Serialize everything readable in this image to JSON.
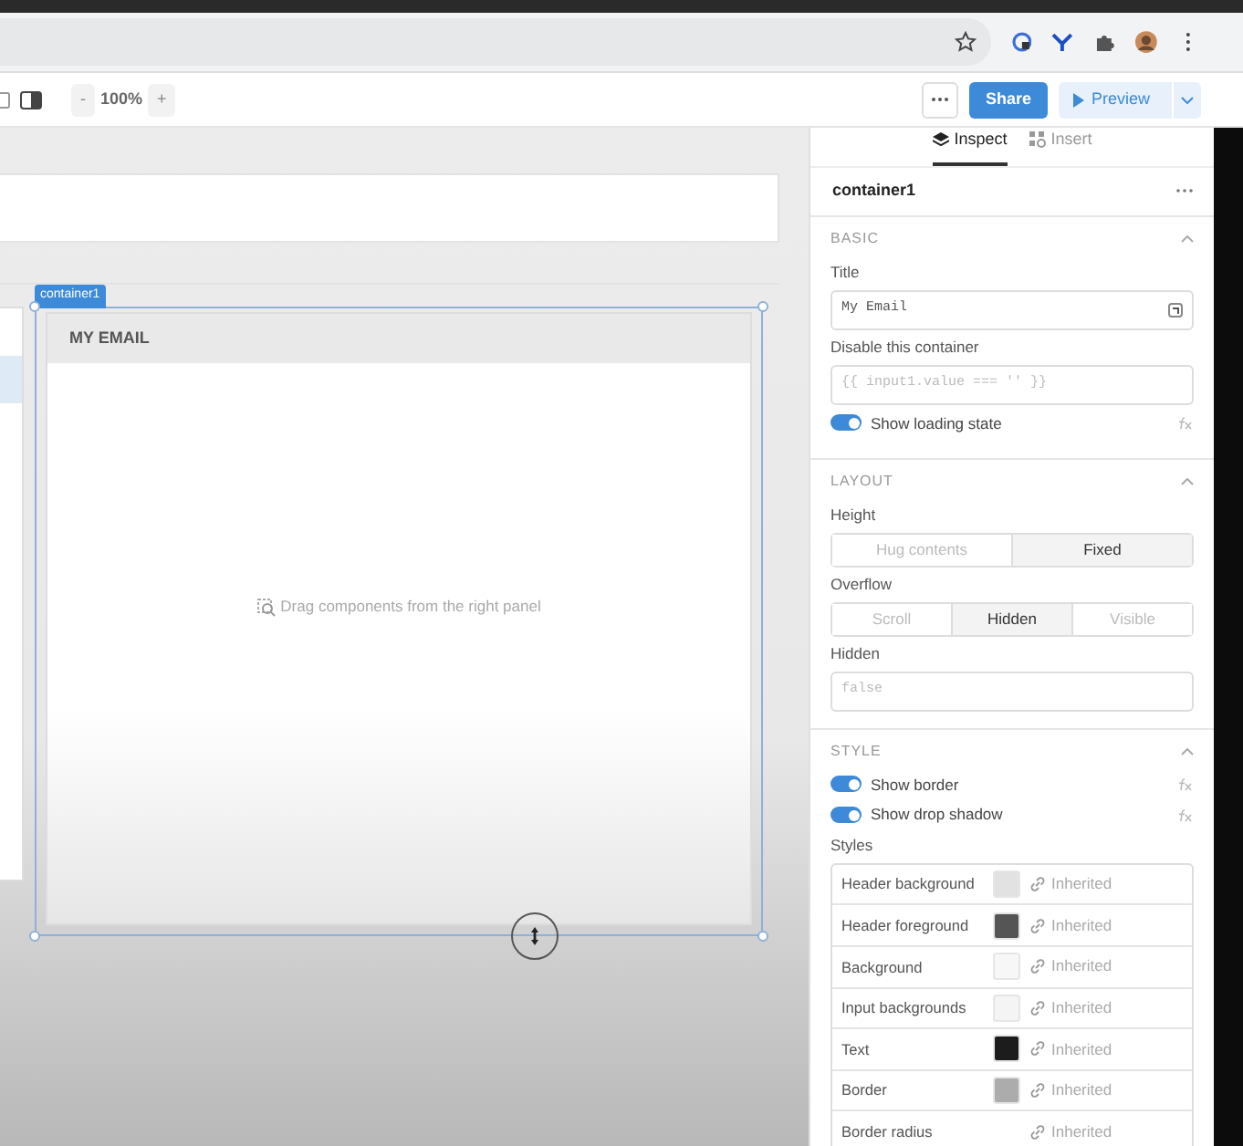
{
  "toolbar": {
    "zoom_out": "-",
    "zoom": "100%",
    "zoom_in": "+",
    "share": "Share",
    "preview": "Preview"
  },
  "canvas": {
    "selection_label": "container1",
    "container": {
      "title": "MY EMAIL",
      "empty_hint": "Drag components from the right panel"
    }
  },
  "inspector": {
    "tabs": [
      {
        "label": "Inspect",
        "selected": true
      },
      {
        "label": "Insert",
        "selected": false
      }
    ],
    "component": "container1",
    "sections": [
      {
        "title": "BASIC",
        "expanded": true,
        "items": [
          {
            "kind": "label",
            "text": "Title"
          },
          {
            "kind": "input",
            "value": "My Email"
          },
          {
            "kind": "label",
            "text": "Disable this container"
          },
          {
            "kind": "input",
            "placeholder": "{{ input1.value === '' }}"
          },
          {
            "kind": "toggle",
            "label": "Show loading state",
            "on": true
          }
        ]
      },
      {
        "title": "LAYOUT",
        "expanded": true,
        "items": [
          {
            "kind": "label",
            "text": "Height"
          },
          {
            "kind": "segmented",
            "options": [
              {
                "label": "Hug contents",
                "selected": false
              },
              {
                "label": "Fixed",
                "selected": true
              }
            ]
          },
          {
            "kind": "label",
            "text": "Overflow"
          },
          {
            "kind": "segmented",
            "options": [
              {
                "label": "Scroll",
                "selected": false
              },
              {
                "label": "Hidden",
                "selected": true
              },
              {
                "label": "Visible",
                "selected": false
              }
            ]
          },
          {
            "kind": "label",
            "text": "Hidden"
          },
          {
            "kind": "input",
            "placeholder": "false"
          }
        ]
      },
      {
        "title": "STYLE",
        "expanded": true,
        "items": [
          {
            "kind": "toggle",
            "label": "Show border",
            "on": true
          },
          {
            "kind": "toggle",
            "label": "Show drop shadow",
            "on": true
          },
          {
            "kind": "label",
            "text": "Styles"
          },
          {
            "kind": "styles",
            "rows": [
              {
                "name": "Header background",
                "color": "#e2e2e2",
                "value": "Inherited"
              },
              {
                "name": "Header foreground",
                "color": "#555555",
                "value": "Inherited"
              },
              {
                "name": "Background",
                "color": "#f7f7f7",
                "value": "Inherited"
              },
              {
                "name": "Input backgrounds",
                "color": "#f4f4f4",
                "value": "Inherited"
              },
              {
                "name": "Text",
                "color": "#1c1c1c",
                "value": "Inherited"
              },
              {
                "name": "Border",
                "color": "#acacac",
                "value": "Inherited"
              },
              {
                "name": "Border radius",
                "value": "Inherited"
              }
            ]
          }
        ]
      }
    ]
  }
}
